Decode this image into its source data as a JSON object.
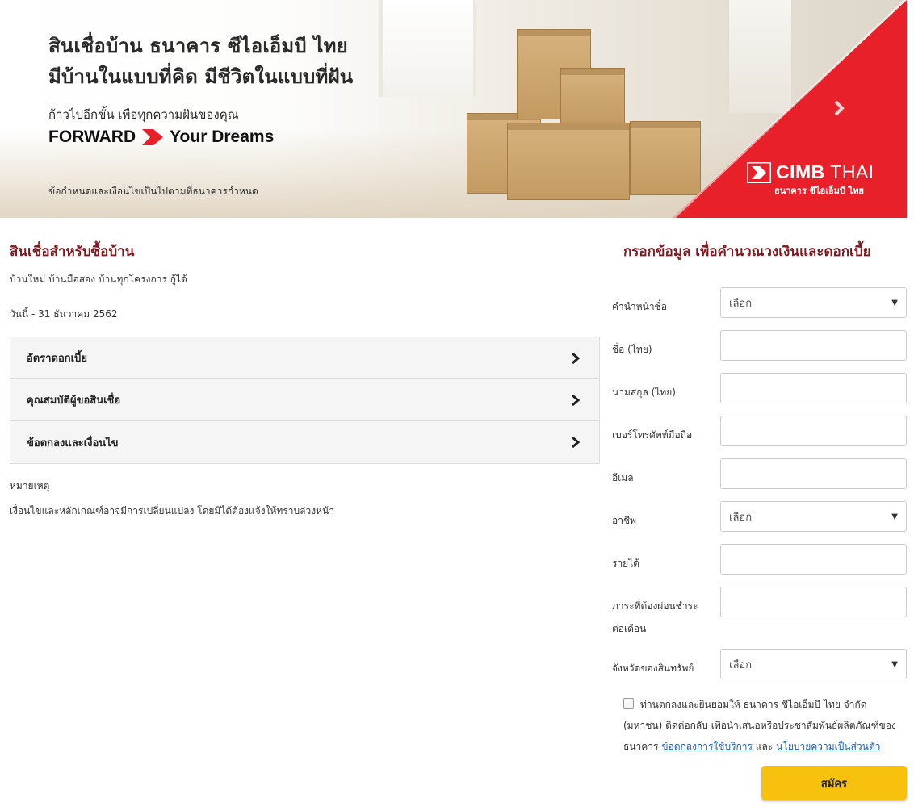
{
  "banner": {
    "headline_line1": "สินเชื่อบ้าน ธนาคาร ซีไอเอ็มบี ไทย",
    "headline_line2": "มีบ้านในแบบที่คิด มีชีวิตในแบบที่ฝัน",
    "tagline": "ก้าวไปอีกขั้น เพื่อทุกความฝันของคุณ",
    "forward_word": "FORWARD",
    "dreams_word": "Your Dreams",
    "disclaimer": "ข้อกำหนดและเงื่อนไขเป็นไปตามที่ธนาคารกำหนด",
    "logo_brand": "CIMB",
    "logo_country": "THAI",
    "logo_subtitle": "ธนาคาร ซีไอเอ็มบี ไทย",
    "accent_color": "#e8202a"
  },
  "product": {
    "title": "สินเชื่อสำหรับซื้อบ้าน",
    "description": "บ้านใหม่ บ้านมือสอง บ้านทุกโครงการ กู้ได้",
    "period": "วันนี้ - 31 ธันวาคม 2562",
    "accordion": [
      {
        "label": "อัตราดอกเบี้ย"
      },
      {
        "label": "คุณสมบัติผู้ขอสินเชื่อ"
      },
      {
        "label": "ข้อตกลงและเงื่อนไข"
      }
    ],
    "note_title": "หมายเหตุ",
    "note_text": "เงื่อนไขและหลักเกณฑ์อาจมีการเปลี่ยนแปลง โดยมิได้ต้องแจ้งให้ทราบล่วงหน้า"
  },
  "form": {
    "title": "กรอกข้อมูล เพื่อคำนวณวงเงินและดอกเบี้ย",
    "fields": [
      {
        "label": "คำนำหน้าชื่อ",
        "type": "select",
        "value": "เลือก"
      },
      {
        "label": "ชื่อ (ไทย)",
        "type": "text",
        "value": ""
      },
      {
        "label": "นามสกุล (ไทย)",
        "type": "text",
        "value": ""
      },
      {
        "label": "เบอร์โทรศัพท์มือถือ",
        "type": "text",
        "value": ""
      },
      {
        "label": "อีเมล",
        "type": "text",
        "value": ""
      },
      {
        "label": "อาชีพ",
        "type": "select",
        "value": "เลือก"
      },
      {
        "label": "รายได้",
        "type": "text",
        "value": ""
      },
      {
        "label": "ภาระที่ต้องผ่อนชำระต่อเดือน",
        "type": "text",
        "value": ""
      },
      {
        "label": "จังหวัดของสินทรัพย์",
        "type": "select",
        "value": "เลือก"
      }
    ],
    "consent_text": "ท่านตกลงและยินยอมให้ ธนาคาร ซีไอเอ็มบี ไทย จำกัด (มหาชน) ติดต่อกลับ เพื่อนำเสนอหรือประชาสัมพันธ์ผลิตภัณฑ์ของธนาคาร",
    "consent_link_terms": "ข้อตกลงการใช้บริการ",
    "consent_and": "และ",
    "consent_link_privacy": "นโยบายความเป็นส่วนตัว",
    "consent_checked": false,
    "submit_label": "สมัคร",
    "submit_color": "#f7c10e"
  }
}
